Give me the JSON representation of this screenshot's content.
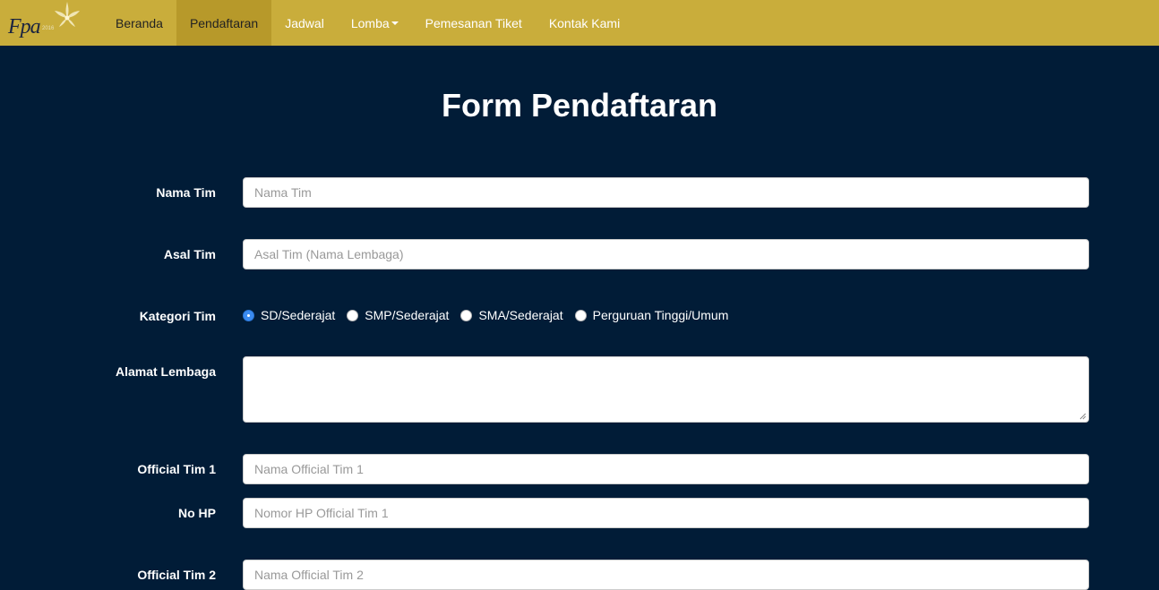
{
  "brand": {
    "logo_text": "Fpa",
    "logo_sub": "2016"
  },
  "nav": {
    "items": [
      {
        "label": "Beranda"
      },
      {
        "label": "Pendaftaran"
      },
      {
        "label": "Jadwal"
      },
      {
        "label": "Lomba"
      },
      {
        "label": "Pemesanan Tiket"
      },
      {
        "label": "Kontak Kami"
      }
    ],
    "active": "Pendaftaran"
  },
  "page": {
    "title": "Form Pendaftaran"
  },
  "form": {
    "nama_tim": {
      "label": "Nama Tim",
      "placeholder": "Nama Tim",
      "value": ""
    },
    "asal_tim": {
      "label": "Asal Tim",
      "placeholder": "Asal Tim (Nama Lembaga)",
      "value": ""
    },
    "kategori": {
      "label": "Kategori Tim",
      "options": [
        "SD/Sederajat",
        "SMP/Sederajat",
        "SMA/Sederajat",
        "Perguruan Tinggi/Umum"
      ],
      "selected": "SD/Sederajat"
    },
    "alamat": {
      "label": "Alamat Lembaga",
      "value": ""
    },
    "official1": {
      "label": "Official Tim 1",
      "placeholder": "Nama Official Tim 1",
      "value": ""
    },
    "nohp1": {
      "label": "No HP",
      "placeholder": "Nomor HP Official Tim 1",
      "value": ""
    },
    "official2": {
      "label": "Official Tim 2",
      "placeholder": "Nama Official Tim 2",
      "value": ""
    }
  },
  "colors": {
    "navbar": "#c9ad3b",
    "navbar_active": "#b7992a",
    "background": "#011c37",
    "radio_checked": "#3b8bf0"
  }
}
